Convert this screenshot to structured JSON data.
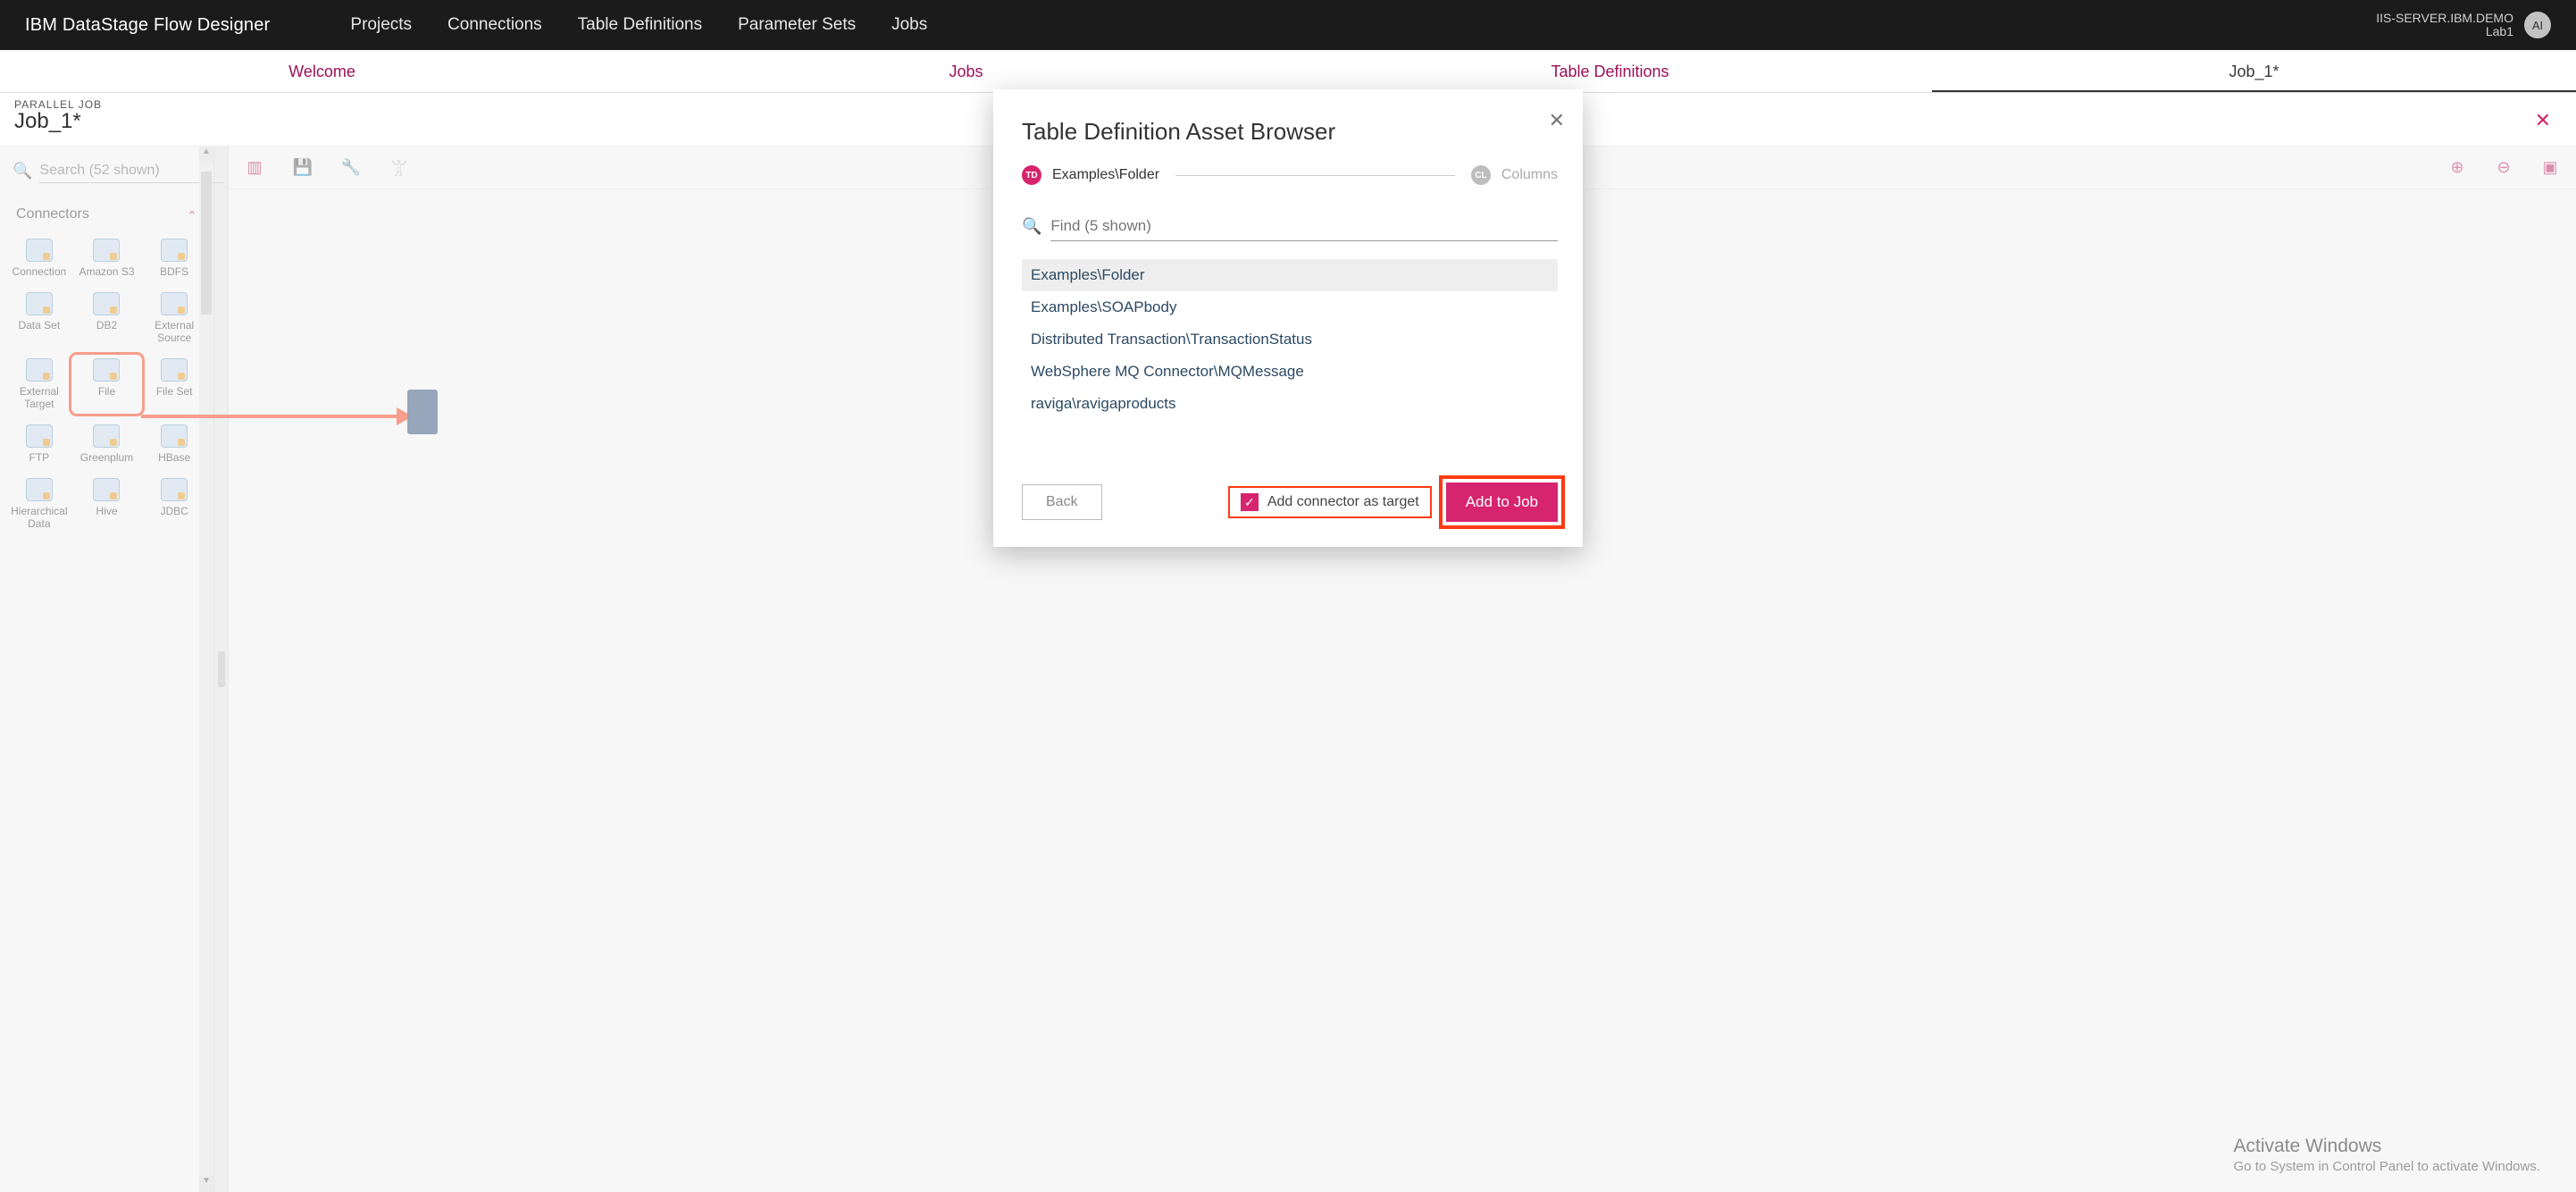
{
  "colors": {
    "accent": "#d6246e",
    "annotate": "#ff3a12"
  },
  "topnav": {
    "brand": "IBM DataStage Flow Designer",
    "items": [
      "Projects",
      "Connections",
      "Table Definitions",
      "Parameter Sets",
      "Jobs"
    ],
    "server_line1": "IIS-SERVER.IBM.DEMO",
    "server_line2": "Lab1",
    "avatar_initials": "AI"
  },
  "subtabs": {
    "items": [
      "Welcome",
      "Jobs",
      "Table Definitions",
      "Job_1*"
    ],
    "active_index": 3
  },
  "job_header": {
    "type_label": "PARALLEL JOB",
    "title": "Job_1*"
  },
  "palette": {
    "search_placeholder": "Search (52 shown)",
    "section_title": "Connectors",
    "nodes": [
      "Connection",
      "Amazon S3",
      "BDFS",
      "Data Set",
      "DB2",
      "External Source",
      "External Target",
      "File",
      "File Set",
      "FTP",
      "Greenplum",
      "HBase",
      "Hierarchical Data",
      "Hive",
      "JDBC"
    ],
    "highlight_node_index": 7
  },
  "canvas_toolbar": {
    "left_icons": [
      "panel-toggle",
      "save",
      "wrench",
      "run"
    ],
    "right_icons": [
      "zoom-in",
      "zoom-out",
      "fit"
    ]
  },
  "modal": {
    "title": "Table Definition Asset Browser",
    "breadcrumb_td": "TD",
    "breadcrumb_path": "Examples\\Folder",
    "breadcrumb_cl": "CL",
    "breadcrumb_columns": "Columns",
    "find_placeholder": "Find (5 shown)",
    "rows": [
      "Examples\\Folder",
      "Examples\\SOAPbody",
      "Distributed Transaction\\TransactionStatus",
      "WebSphere MQ Connector\\MQMessage",
      "raviga\\ravigaproducts"
    ],
    "selected_row_index": 0,
    "back_label": "Back",
    "checkbox_label": "Add connector as target",
    "checkbox_checked": true,
    "primary_label": "Add to Job"
  },
  "watermark": {
    "line1": "Activate Windows",
    "line2": "Go to System in Control Panel to activate Windows."
  }
}
